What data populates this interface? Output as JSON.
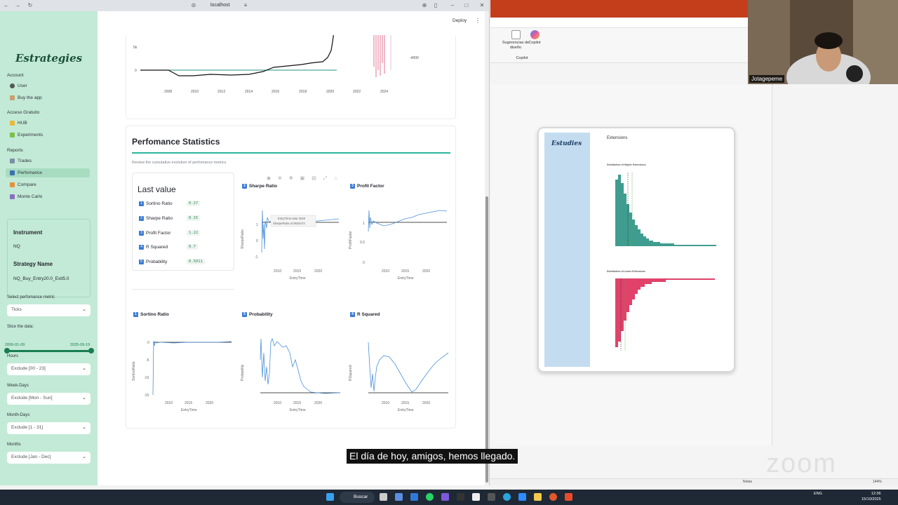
{
  "browser": {
    "url": "localhost",
    "deploy_label": "Deploy"
  },
  "sidebar": {
    "logo": "Estrategies",
    "account_heading": "Account",
    "account_items": [
      {
        "label": "User",
        "icon": "user-icon"
      },
      {
        "label": "Buy the app",
        "icon": "cart-icon"
      }
    ],
    "free_heading": "Acceso Gratuito",
    "free_items": [
      {
        "label": "HUB",
        "icon": "folder-icon"
      },
      {
        "label": "Experiments",
        "icon": "check-icon"
      }
    ],
    "reports_heading": "Reports",
    "report_items": [
      {
        "label": "Trades",
        "icon": "bar-chart-icon"
      },
      {
        "label": "Perfomance",
        "icon": "line-chart-icon",
        "active": true
      },
      {
        "label": "Compare",
        "icon": "compare-icon"
      },
      {
        "label": "Monte Carlo",
        "icon": "dice-icon"
      }
    ],
    "instrument_title": "Instrument",
    "instrument_value": "NQ",
    "strategy_title": "Strategy Name",
    "strategy_value": "NQ_Buy_Entry20.0_Exit5.0",
    "metric_label": "Select perfomance metric",
    "metric_value": "Ticks",
    "slice_label": "Slice the data:",
    "slice_start": "2006-01-09",
    "slice_end": "2025-09-19",
    "filters": [
      {
        "label": "Hours",
        "value": "Exclude [00 - 23]"
      },
      {
        "label": "Week-Days",
        "value": "Exclude [Mon - Sun]"
      },
      {
        "label": "Month-Days",
        "value": "Exclude [1 - 31]"
      },
      {
        "label": "Months",
        "value": "Exclude [Jan - Dec]"
      }
    ]
  },
  "top_chart": {
    "x_ticks": [
      "2008",
      "2010",
      "2012",
      "2014",
      "2016",
      "2018",
      "2020",
      "2022",
      "2024"
    ],
    "y_ticks": [
      "5k",
      "0"
    ],
    "right_tick": "-4000"
  },
  "stats": {
    "title": "Perfomance Statistics",
    "subtitle": "Review the cumulative evolution of perfomance metrics",
    "last_value_title": "Last value",
    "last_values": [
      {
        "num": "1",
        "label": "Sortino Ratio",
        "value": "0.27"
      },
      {
        "num": "2",
        "label": "Sharpe Ratio",
        "value": "0.15"
      },
      {
        "num": "3",
        "label": "Profit Factor",
        "value": "1.22"
      },
      {
        "num": "4",
        "label": "R Squared",
        "value": "0.7"
      },
      {
        "num": "5",
        "label": "Probability",
        "value": "0.5011"
      }
    ],
    "tooltip": {
      "line1": "EntryTime=Mar 2020",
      "line2": "SharpeRatio=0.0634473"
    }
  },
  "charts": [
    {
      "num": "2",
      "title": "Sharpe Ratio",
      "ylabel": "SharpeRatio",
      "xlabel": "EntryTime",
      "y_ticks": [
        "1",
        "0",
        "-1"
      ],
      "x_ticks": [
        "2010",
        "2015",
        "2020"
      ]
    },
    {
      "num": "3",
      "title": "Profit Factor",
      "ylabel": "ProfitFactor",
      "xlabel": "EntryTime",
      "y_ticks": [
        "1",
        "0.5",
        "0"
      ],
      "x_ticks": [
        "2010",
        "2015",
        "2020"
      ]
    },
    {
      "num": "1",
      "title": "Sortino Ratio",
      "ylabel": "SortinoRatio",
      "xlabel": "EntryTime",
      "y_ticks": [
        "0",
        "-5",
        "-10",
        "-15"
      ],
      "x_ticks": [
        "2010",
        "2015",
        "2020"
      ]
    },
    {
      "num": "5",
      "title": "Probability",
      "ylabel": "Probability",
      "xlabel": "EntryTime",
      "y_ticks": [],
      "x_ticks": [
        "2010",
        "2015",
        "2020"
      ]
    },
    {
      "num": "4",
      "title": "R Squared",
      "ylabel": "RSquared",
      "xlabel": "EntryTime",
      "y_ticks": [],
      "x_ticks": [
        "2010",
        "2015",
        "2020"
      ]
    }
  ],
  "ppt": {
    "tool1": "Sugerencias de diseño",
    "tool2": "Copilot",
    "group": "Copilot",
    "status_notes": "Notas",
    "zoom_pct": "144%"
  },
  "slide": {
    "logo": "Estudies",
    "heading": "Extensions",
    "chart1_title": "Distribution of Higher Extensions",
    "chart2_title": "Distribution of Lower Extensions"
  },
  "camera": {
    "name": "Jotagepeme"
  },
  "caption": "El día de hoy, amigos, hemos llegado.",
  "taskbar": {
    "search": "Buscar",
    "lang": "ENG",
    "time": "12:36",
    "date": "15/10/2025"
  },
  "watermark": "zoom",
  "colors": {
    "sidebar_bg": "#c2ead6",
    "accent": "#2ab59b",
    "line": "#4a90d9",
    "green_hist": "#3f9d8f",
    "red_hist": "#e0426a"
  }
}
